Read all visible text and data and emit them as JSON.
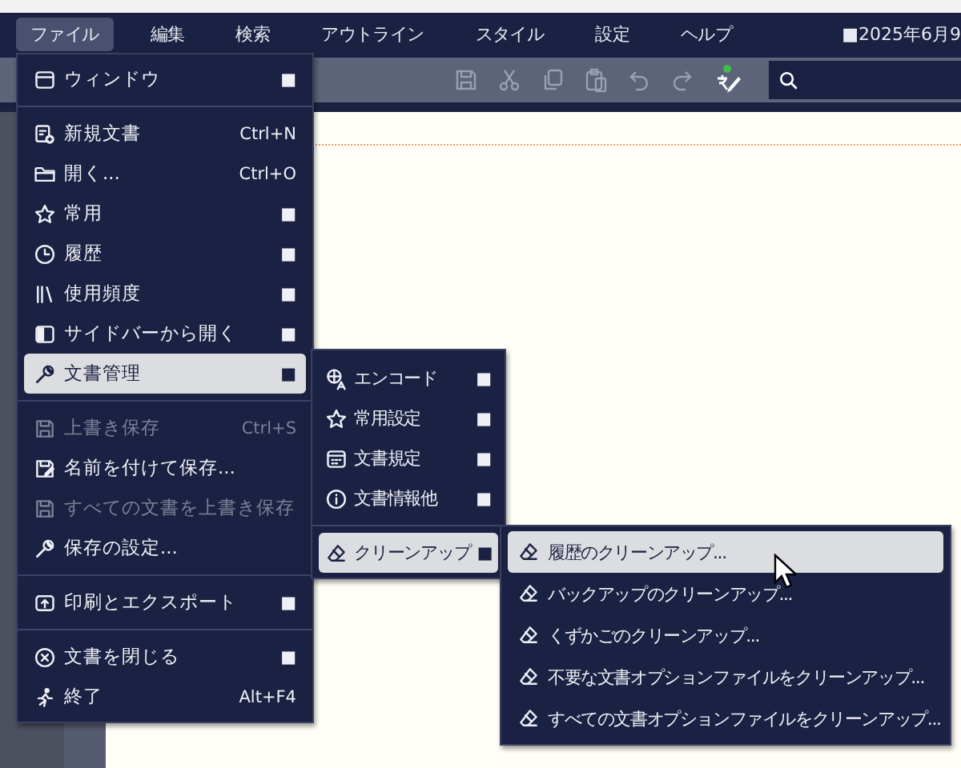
{
  "menubar": {
    "items": [
      {
        "label": "ファイル",
        "selected": true
      },
      {
        "label": "編集",
        "selected": false
      },
      {
        "label": "検索",
        "selected": false
      },
      {
        "label": "アウトライン",
        "selected": false
      },
      {
        "label": "スタイル",
        "selected": false
      },
      {
        "label": "設定",
        "selected": false
      },
      {
        "label": "ヘルプ",
        "selected": false
      }
    ],
    "date": "■2025年6月9"
  },
  "file_menu": {
    "items": [
      {
        "kind": "item",
        "label": "ウィンドウ",
        "shortcut": "■",
        "selected": false,
        "disabled": false
      },
      {
        "kind": "separator"
      },
      {
        "kind": "item",
        "label": "新規文書",
        "shortcut": "Ctrl+N",
        "selected": false,
        "disabled": false
      },
      {
        "kind": "item",
        "label": "開く...",
        "shortcut": "Ctrl+O",
        "selected": false,
        "disabled": false
      },
      {
        "kind": "item",
        "label": "常用",
        "shortcut": "■",
        "selected": false,
        "disabled": false
      },
      {
        "kind": "item",
        "label": "履歴",
        "shortcut": "■",
        "selected": false,
        "disabled": false
      },
      {
        "kind": "item",
        "label": "使用頻度",
        "shortcut": "■",
        "selected": false,
        "disabled": false
      },
      {
        "kind": "item",
        "label": "サイドバーから開く",
        "shortcut": "■",
        "selected": false,
        "disabled": false
      },
      {
        "kind": "item",
        "label": "文書管理",
        "shortcut": "■",
        "selected": true,
        "disabled": false
      },
      {
        "kind": "separator"
      },
      {
        "kind": "item",
        "label": "上書き保存",
        "shortcut": "Ctrl+S",
        "selected": false,
        "disabled": true
      },
      {
        "kind": "item",
        "label": "名前を付けて保存...",
        "selected": false,
        "disabled": false
      },
      {
        "kind": "item",
        "label": "すべての文書を上書き保存",
        "selected": false,
        "disabled": true
      },
      {
        "kind": "item",
        "label": "保存の設定...",
        "selected": false,
        "disabled": false
      },
      {
        "kind": "separator"
      },
      {
        "kind": "item",
        "label": "印刷とエクスポート",
        "shortcut": "■",
        "selected": false,
        "disabled": false
      },
      {
        "kind": "separator"
      },
      {
        "kind": "item",
        "label": "文書を閉じる",
        "shortcut": "■",
        "selected": false,
        "disabled": false
      },
      {
        "kind": "item",
        "label": "終了",
        "shortcut": "Alt+F4",
        "selected": false,
        "disabled": false
      }
    ]
  },
  "document_menu": {
    "items": [
      {
        "kind": "item",
        "label": "エンコード",
        "shortcut": "■",
        "selected": false,
        "disabled": false
      },
      {
        "kind": "item",
        "label": "常用設定",
        "shortcut": "■",
        "selected": false,
        "disabled": false
      },
      {
        "kind": "item",
        "label": "文書規定",
        "shortcut": "■",
        "selected": false,
        "disabled": false
      },
      {
        "kind": "item",
        "label": "文書情報他",
        "shortcut": "■",
        "selected": false,
        "disabled": false
      },
      {
        "kind": "separator"
      },
      {
        "kind": "item",
        "label": "クリーンアップ",
        "shortcut": "■",
        "selected": true,
        "disabled": false
      }
    ]
  },
  "cleanup_menu": {
    "items": [
      {
        "kind": "item",
        "label": "履歴のクリーンアップ...",
        "selected": true,
        "disabled": false
      },
      {
        "kind": "item",
        "label": "バックアップのクリーンアップ...",
        "selected": false,
        "disabled": false
      },
      {
        "kind": "item",
        "label": "くずかごのクリーンアップ...",
        "selected": false,
        "disabled": false
      },
      {
        "kind": "item",
        "label": "不要な文書オプションファイルをクリーンアップ...",
        "selected": false,
        "disabled": false
      },
      {
        "kind": "item",
        "label": "すべての文書オプションファイルをクリーンアップ...",
        "selected": false,
        "disabled": false
      }
    ]
  }
}
